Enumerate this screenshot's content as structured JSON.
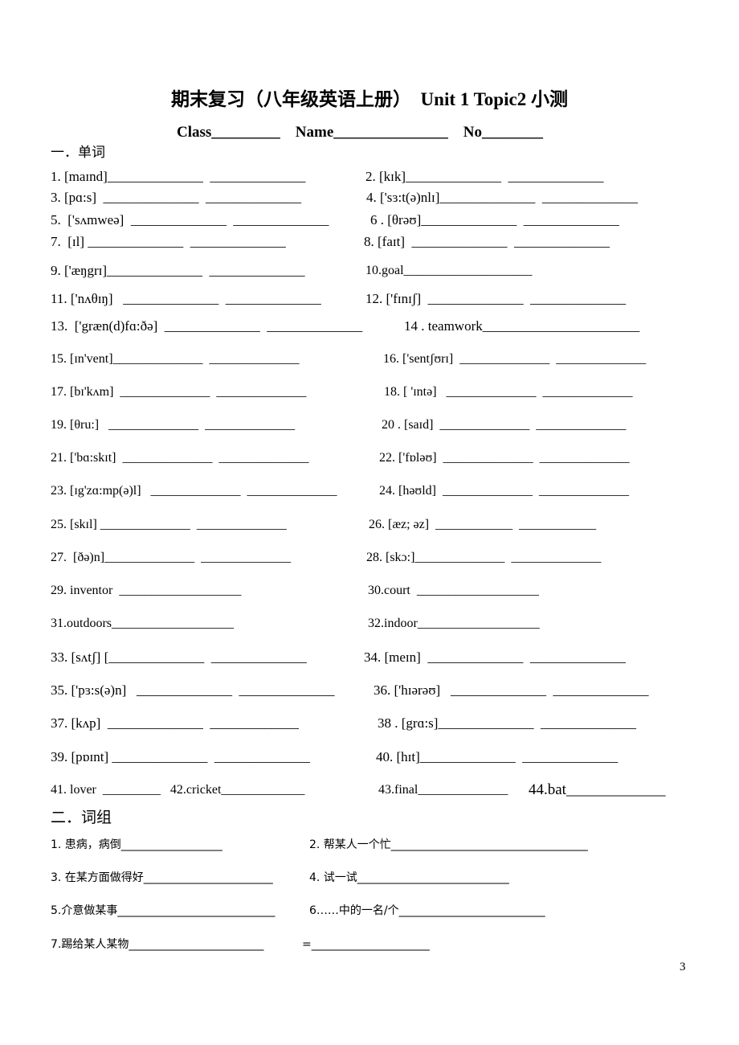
{
  "title": "期末复习（八年级英语上册）  Unit 1 Topic2 小测",
  "info_line": "Class_________    Name_______________    No________",
  "section1": "一．单词",
  "words": [
    "1. [maɪnd]______________  ______________",
    "2. [kɪk]______________  ______________",
    "3. [pɑ:s]  ______________  ______________",
    "4. ['sɜ:t(ə)nlɪ]______________  ______________",
    "5.  ['sʌmweə]  ______________  ______________",
    "6 . [θrəʊ]______________  ______________",
    "7.  [ɪl] ______________  ______________",
    "8. [faɪt]  ______________  ______________",
    "9. ['æŋgrɪ]______________  ______________",
    "10.goal____________________",
    "11. ['nʌθɪŋ]   ______________  ______________",
    "12. ['fɪnɪʃ]  ______________  ______________",
    "13.  ['græn(d)fɑ:ðə]  ______________  ______________",
    "14 . teamwork_______________________",
    "15. [ɪn'vent]______________  ______________",
    "16. ['sentʃʊrɪ]  ______________  ______________",
    "17. [bɪ'kʌm]  ______________  ______________",
    "18. [ 'ɪntə]   ______________  ______________",
    "19. [θru:]   ______________  ______________",
    "20 . [saɪd]  ______________  ______________",
    "21. ['bɑ:skɪt]  ______________  ______________",
    "22. ['fɒləʊ]  ______________  ______________",
    "23. [ɪg'zɑ:mp(ə)l]   ______________  ______________",
    "24. [həʊld]  ______________  ______________",
    "25. [skɪl] ______________  ______________",
    "26. [æz; əz]  ____________  ____________",
    "27.  [ðə)n]______________  ______________",
    "28. [skɔ:]______________  ______________",
    "29. inventor  ___________________",
    "30.court  ___________________",
    "31.outdoors___________________",
    "32.indoor___________________",
    "33. [sʌtʃ] [______________  ______________",
    "34. [meɪn]  ______________  ______________",
    "35. ['pɜ:s(ə)n]   ______________  ______________",
    "36. ['hɪərəʊ]   ______________  ______________",
    "37. [kʌp]  ______________  _____________",
    "38 . [grɑ:s]______________  ______________",
    "39. [pɒɪnt] ______________  ______________",
    "40. [hɪt]______________  ______________",
    "41. lover  _________   42.cricket_____________",
    "43.final______________",
    "44.bat_____________"
  ],
  "section2": "二．词组",
  "phrases": [
    "1. 患病，病倒__________________",
    "2. 帮某人一个忙___________________________________",
    "3. 在某方面做得好_______________________",
    "4. 试一试___________________________",
    "5.介意做某事____________________________",
    "6……中的一名/个__________________________",
    "7.踢给某人某物________________________",
    "=_____________________"
  ],
  "page_number": "3"
}
